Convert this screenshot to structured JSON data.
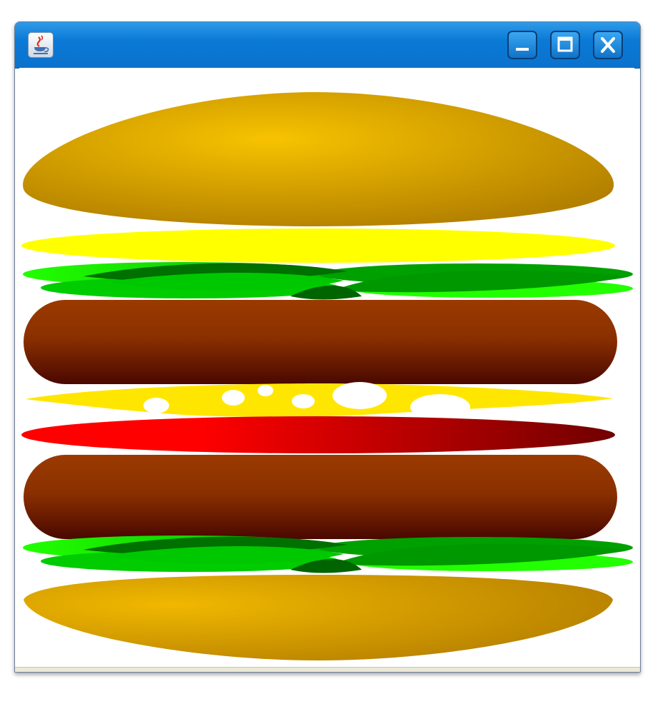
{
  "window": {
    "title": "",
    "controls": {
      "minimize_icon": "minimize-icon",
      "maximize_icon": "maximize-icon",
      "close_icon": "close-icon"
    },
    "app_icon": "java-cup-icon"
  },
  "colors": {
    "titlebar": "#0a7ad6",
    "bun": "#d4a300",
    "bun_highlight": "#f5c000",
    "cheese_slice": "#ffff00",
    "lettuce_light": "#22ff00",
    "lettuce_dark": "#007a00",
    "patty_top": "#9a3a00",
    "patty_bottom": "#4a0a00",
    "swiss_cheese": "#ffe600",
    "tomato_left": "#ff0000",
    "tomato_right": "#780000"
  },
  "burger": {
    "layers": [
      "top-bun",
      "cheese-slice",
      "lettuce",
      "patty",
      "swiss-cheese",
      "tomato",
      "patty",
      "lettuce",
      "bottom-bun"
    ]
  }
}
